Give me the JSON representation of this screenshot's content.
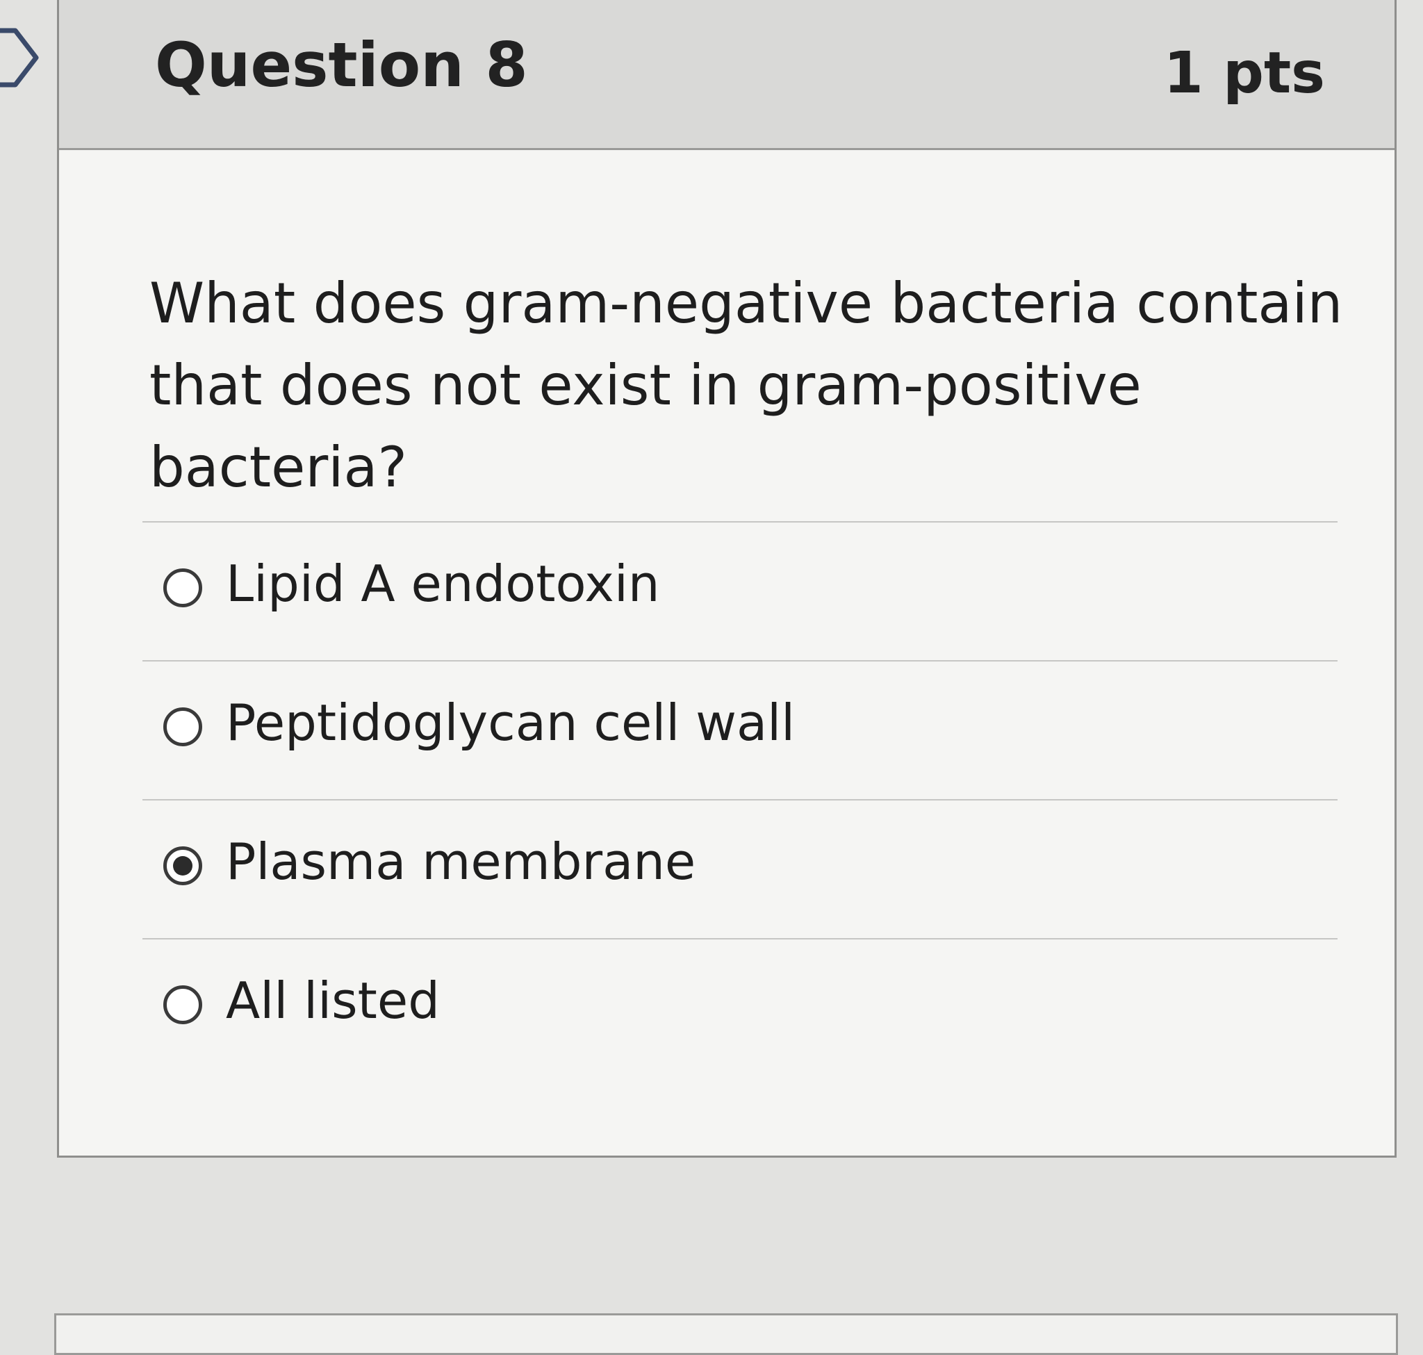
{
  "question": {
    "title": "Question 8",
    "points": "1 pts",
    "text": "What does gram-negative bacteria contain that does not exist in gram-positive bacteria?",
    "flag_icon": "flag-icon"
  },
  "answers": [
    {
      "label": "Lipid A endotoxin",
      "selected": false
    },
    {
      "label": "Peptidoglycan cell wall",
      "selected": false
    },
    {
      "label": "Plasma membrane",
      "selected": true
    },
    {
      "label": "All listed",
      "selected": false
    }
  ],
  "colors": {
    "header_bg": "#d9d9d7",
    "card_bg": "#f5f5f3",
    "page_bg": "#e2e2e0",
    "text": "#222222"
  }
}
